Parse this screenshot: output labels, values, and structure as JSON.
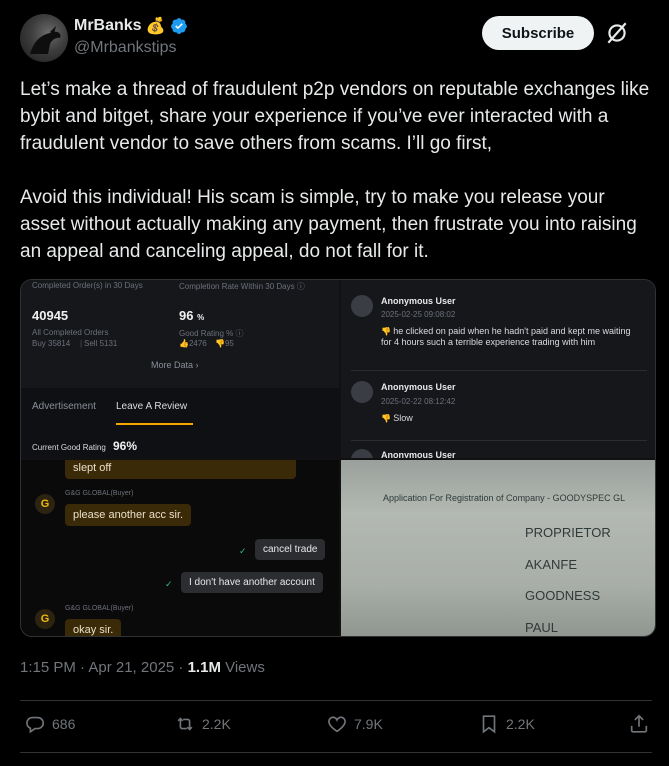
{
  "author": {
    "display_name": "MrBanks",
    "emoji": "💰",
    "handle": "@Mrbankstips",
    "verified_color": "#1d9bf0"
  },
  "header": {
    "subscribe_label": "Subscribe",
    "grok_icon": "grok-icon"
  },
  "tweet": {
    "text": "Let’s make a thread of fraudulent p2p vendors on reputable exchanges like bybit and bitget, share your experience if you’ve ever interacted with a fraudulent vendor to save others from scams. I’ll go first,\n\nAvoid this individual! His scam is simple, try to make you release your asset without actually making any payment, then frustrate you into raising an appeal and canceling appeal, do not fall for it."
  },
  "media": {
    "stats": {
      "orders_label": "Completed Order(s) in 30 Days",
      "orders_value": "40945",
      "all_completed_label": "All Completed Orders",
      "buy": "Buy 35814",
      "sell": "Sell 5131",
      "completion_label": "Completion Rate Within 30 Days ⓘ",
      "completion_value": "96",
      "completion_unit": "%",
      "good_rating_label": "Good Rating % ⓘ",
      "likes": "👍2476",
      "dislikes": "👎95",
      "more_data": "More Data ›",
      "tab_ad": "Advertisement",
      "tab_review": "Leave A Review",
      "current_rating_label": "Current Good Rating",
      "current_rating_value": "96%"
    },
    "reviews": [
      {
        "name": "Anonymous User",
        "date": "2025-02-25 09:08:02",
        "text": "he clicked on paid when he hadn't paid and kept me waiting for 4 hours such a terrible experience trading with him"
      },
      {
        "name": "Anonymous User",
        "date": "2025-02-22 08:12:42",
        "text": "Slow"
      },
      {
        "name": "Anonymous User",
        "date": "",
        "text": ""
      }
    ],
    "chat": {
      "msg1": "slept off",
      "sender1": "G&G GLOBAL(Buyer)",
      "msg2": "please another acc sir.",
      "reply1": "cancel trade",
      "reply2": "I don't have another account",
      "sender2": "G&G GLOBAL(Buyer)",
      "msg3": "okay sir.",
      "avatar_letter": "G"
    },
    "document": {
      "heading": "Application For Registration of Company - GOODYSPEC GL",
      "line1": "PROPRIETOR",
      "line2": "AKANFE",
      "line3": "GOODNESS",
      "line4": "PAUL"
    }
  },
  "meta": {
    "time": "1:15 PM · Apr 21, 2025 · ",
    "views_count": "1.1M",
    "views_label": " Views"
  },
  "actions": {
    "replies": "686",
    "reposts": "2.2K",
    "likes": "7.9K",
    "bookmarks": "2.2K"
  }
}
